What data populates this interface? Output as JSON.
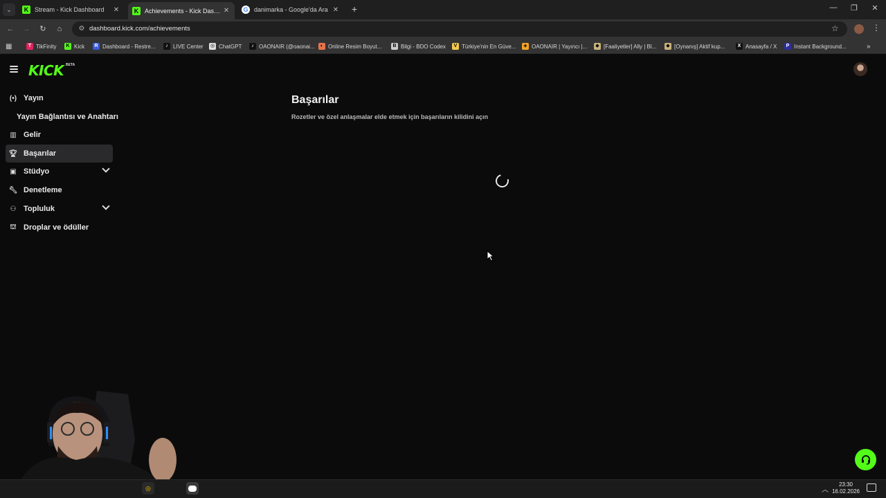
{
  "browser": {
    "tabs": [
      {
        "label": "Stream - Kick Dashboard",
        "favicon": "kick-icon",
        "active": false
      },
      {
        "label": "Achievements - Kick Dashboard",
        "favicon": "kick-icon",
        "active": true
      },
      {
        "label": "danimarka - Google'da Ara",
        "favicon": "google-icon",
        "active": false
      }
    ],
    "url": "dashboard.kick.com/achievements",
    "bookmarks": [
      {
        "label": "TikFinity",
        "icon": "tikfinity-icon",
        "color": "#e0245e"
      },
      {
        "label": "Kick",
        "icon": "kick-icon",
        "color": "#53fc18"
      },
      {
        "label": "Dashboard - Restre...",
        "icon": "restream-icon",
        "color": "#3b5bdb"
      },
      {
        "label": "LIVE Center",
        "icon": "tiktok-icon",
        "color": "#111111"
      },
      {
        "label": "ChatGPT",
        "icon": "chatgpt-icon",
        "color": "#e0e0e0"
      },
      {
        "label": "OAONAIR (@oaonai...",
        "icon": "tiktok-icon",
        "color": "#111111"
      },
      {
        "label": "Online Resim Boyut...",
        "icon": "resize-icon",
        "color": "#e8744a"
      },
      {
        "label": "Bilgi - BDO Codex",
        "icon": "bdo-icon",
        "color": "#cccccc"
      },
      {
        "label": "Türkiye'nin En Güve...",
        "icon": "v-icon",
        "color": "#f2c94c"
      },
      {
        "label": "OAONAIR | Yayıncı |...",
        "icon": "streamer-icon",
        "color": "#f5a623"
      },
      {
        "label": "[Faaliyetler] Ally | Bl...",
        "icon": "game-icon",
        "color": "#c8b27a"
      },
      {
        "label": "[Oynanış] Aktif kup...",
        "icon": "game-icon",
        "color": "#c8b27a"
      },
      {
        "label": "Anasayfa / X",
        "icon": "x-icon",
        "color": "#111111"
      },
      {
        "label": "Instant Background...",
        "icon": "p-icon",
        "color": "#2b2f9e"
      }
    ],
    "more_bookmarks": "»"
  },
  "app": {
    "logo": "KICK",
    "logo_badge": "BETA",
    "brand_color": "#53fc18",
    "nav": [
      {
        "label": "Yayın",
        "icon": "broadcast-icon"
      },
      {
        "label": "Yayın Bağlantısı ve Anahtarı",
        "sub": true
      },
      {
        "label": "Gelir",
        "icon": "chart-icon"
      },
      {
        "label": "Başarılar",
        "icon": "trophy-icon",
        "active": true
      },
      {
        "label": "Stüdyo",
        "icon": "studio-icon",
        "expandable": true
      },
      {
        "label": "Denetleme",
        "icon": "wrench-icon"
      },
      {
        "label": "Topluluk",
        "icon": "community-icon",
        "expandable": true
      },
      {
        "label": "Droplar ve ödüller",
        "icon": "gift-icon"
      }
    ],
    "page": {
      "title": "Başarılar",
      "subtitle": "Rozetler ve özel anlaşmalar elde etmek için başarıların kilidini açın"
    }
  },
  "taskbar": {
    "time": "23:30",
    "date": "16.02.2026"
  }
}
